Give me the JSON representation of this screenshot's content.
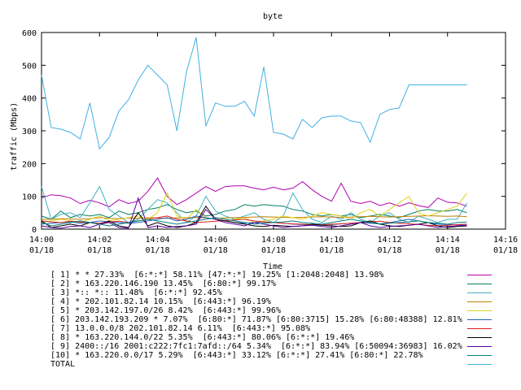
{
  "chart_data": {
    "type": "line",
    "title": "byte",
    "xlabel": "Time",
    "ylabel": "traffic (Mbps)",
    "ylim": [
      0,
      600
    ],
    "yticks": [
      0,
      100,
      200,
      300,
      400,
      500,
      600
    ],
    "grid": false,
    "xtick_labels": [
      {
        "time": "14:00",
        "date": "01/18"
      },
      {
        "time": "14:02",
        "date": "01/18"
      },
      {
        "time": "14:04",
        "date": "01/18"
      },
      {
        "time": "14:06",
        "date": "01/18"
      },
      {
        "time": "14:08",
        "date": "01/18"
      },
      {
        "time": "14:10",
        "date": "01/18"
      },
      {
        "time": "14:12",
        "date": "01/18"
      },
      {
        "time": "14:14",
        "date": "01/18"
      },
      {
        "time": "14:16",
        "date": "01/18"
      }
    ],
    "x": [
      "14:00:00",
      "14:00:20",
      "14:00:40",
      "14:01:00",
      "14:01:20",
      "14:01:40",
      "14:02:00",
      "14:02:20",
      "14:02:40",
      "14:03:00",
      "14:03:20",
      "14:03:40",
      "14:04:00",
      "14:04:20",
      "14:04:40",
      "14:05:00",
      "14:05:20",
      "14:05:40",
      "14:06:00",
      "14:06:20",
      "14:06:40",
      "14:07:00",
      "14:07:20",
      "14:07:40",
      "14:08:00",
      "14:08:20",
      "14:08:40",
      "14:09:00",
      "14:09:20",
      "14:09:40",
      "14:10:00",
      "14:10:20",
      "14:10:40",
      "14:11:00",
      "14:11:20",
      "14:11:40",
      "14:12:00",
      "14:12:20",
      "14:12:40",
      "14:13:00",
      "14:13:20",
      "14:13:40",
      "14:14:00",
      "14:14:20",
      "14:14:40"
    ],
    "series": [
      {
        "name": "[ 1] * * 27.33%  [6:*:*] 58.11% [47:*:*] 19.25% [1:2048:2048] 13.98%",
        "color": "#b000b0",
        "values": [
          95,
          105,
          102,
          95,
          78,
          88,
          80,
          68,
          90,
          78,
          85,
          115,
          156,
          100,
          75,
          90,
          110,
          130,
          115,
          130,
          132,
          132,
          125,
          120,
          128,
          120,
          125,
          145,
          120,
          100,
          85,
          140,
          85,
          78,
          85,
          72,
          80,
          70,
          80,
          72,
          66,
          95,
          82,
          80,
          70
        ]
      },
      {
        "name": "[ 2] * 163.220.146.190 13.45%  [6:80:*] 99.17%",
        "color": "#008060",
        "values": [
          40,
          30,
          55,
          35,
          45,
          40,
          45,
          35,
          55,
          45,
          50,
          60,
          65,
          75,
          60,
          50,
          55,
          40,
          45,
          55,
          60,
          75,
          70,
          75,
          72,
          70,
          60,
          55,
          45,
          40,
          45,
          40,
          45,
          35,
          40,
          45,
          40,
          35,
          45,
          55,
          60,
          55,
          55,
          60,
          50
        ]
      },
      {
        "name": "[ 3] *:: *:: 11.48%  [6:*:*] 92.45%",
        "color": "#40b0c0",
        "values": [
          130,
          30,
          45,
          50,
          35,
          80,
          130,
          60,
          40,
          20,
          30,
          60,
          90,
          80,
          50,
          20,
          40,
          100,
          55,
          40,
          30,
          40,
          50,
          30,
          20,
          40,
          110,
          60,
          30,
          20,
          40,
          30,
          50,
          30,
          20,
          40,
          50,
          30,
          20,
          40,
          30,
          20,
          30,
          30,
          80
        ]
      },
      {
        "name": "[ 4] * 202.101.82.14 10.15%  [6:443:*] 96.19%",
        "color": "#c08000",
        "values": [
          30,
          30,
          32,
          31,
          30,
          32,
          35,
          33,
          32,
          34,
          33,
          35,
          34,
          33,
          34,
          35,
          36,
          34,
          33,
          34,
          35,
          36,
          37,
          38,
          37,
          36,
          35,
          36,
          37,
          38,
          37,
          36,
          37,
          38,
          39,
          38,
          37,
          38,
          39,
          40,
          41,
          40,
          39,
          40,
          38
        ]
      },
      {
        "name": "[ 5] * 203.142.197.0/26 8.42%  [6:443:*] 99.96%",
        "color": "#e0d020",
        "values": [
          20,
          25,
          30,
          25,
          20,
          30,
          40,
          25,
          30,
          35,
          40,
          30,
          50,
          110,
          40,
          30,
          60,
          35,
          30,
          25,
          30,
          35,
          20,
          25,
          30,
          40,
          35,
          30,
          40,
          50,
          45,
          40,
          30,
          50,
          60,
          40,
          60,
          80,
          100,
          50,
          40,
          50,
          60,
          70,
          110
        ]
      },
      {
        "name": "[ 6] 203.142.193.209 * 7.07%  [6:80:*] 71.87% [6:80:3715] 15.28% [6:80:48388] 12.81%",
        "color": "#2060c0",
        "values": [
          15,
          18,
          20,
          22,
          18,
          20,
          25,
          22,
          20,
          18,
          20,
          25,
          30,
          35,
          25,
          30,
          40,
          35,
          30,
          25,
          20,
          18,
          20,
          22,
          20,
          18,
          15,
          14,
          13,
          12,
          14,
          16,
          18,
          20,
          18,
          16,
          20,
          25,
          30,
          25,
          20,
          15,
          14,
          13,
          12
        ]
      },
      {
        "name": "[ 7] 13.0.0.0/8 202.101.82.14 6.11%  [6:443:*] 95.08%",
        "color": "#e02020",
        "values": [
          25,
          22,
          20,
          24,
          22,
          20,
          18,
          22,
          24,
          20,
          25,
          30,
          35,
          40,
          30,
          25,
          20,
          22,
          24,
          26,
          28,
          30,
          25,
          22,
          20,
          18,
          16,
          15,
          14,
          13,
          15,
          16,
          18,
          20,
          22,
          24,
          20,
          18,
          16,
          14,
          12,
          10,
          12,
          14,
          15
        ]
      },
      {
        "name": "[ 8] * 163.220.144.0/22 5.35%  [6:443:*] 80.06% [6:*:*] 19.46%",
        "color": "#000000",
        "values": [
          25,
          5,
          10,
          15,
          10,
          20,
          15,
          25,
          10,
          5,
          50,
          10,
          20,
          10,
          5,
          10,
          20,
          70,
          30,
          25,
          20,
          15,
          10,
          8,
          12,
          10,
          8,
          10,
          15,
          12,
          10,
          8,
          10,
          20,
          25,
          15,
          10,
          8,
          12,
          15,
          20,
          10,
          5,
          8,
          10
        ]
      },
      {
        "name": "[ 9] 2400::/16 2001:c222:7fc1:7afd::/64 5.34%  [6:*:*] 83.94% [6:50094:36983] 16.02%",
        "color": "#6000a0",
        "values": [
          10,
          5,
          3,
          8,
          10,
          5,
          15,
          20,
          5,
          3,
          95,
          5,
          10,
          5,
          8,
          10,
          15,
          60,
          30,
          20,
          15,
          10,
          20,
          15,
          10,
          5,
          8,
          10,
          12,
          8,
          5,
          10,
          15,
          20,
          10,
          5,
          8,
          10,
          12,
          15,
          10,
          5,
          8,
          10,
          12
        ]
      },
      {
        "name": "[10] * 163.220.0.0/17 5.29%  [6:443:*] 33.12% [6:*:*] 27.41% [6:80:*] 22.78%",
        "color": "#008080",
        "values": [
          20,
          10,
          15,
          20,
          25,
          20,
          15,
          10,
          15,
          20,
          25,
          30,
          25,
          20,
          15,
          20,
          25,
          30,
          35,
          30,
          25,
          20,
          15,
          18,
          20,
          22,
          25,
          20,
          18,
          15,
          20,
          25,
          30,
          25,
          20,
          15,
          18,
          20,
          22,
          25,
          20,
          18,
          15,
          20,
          22
        ]
      },
      {
        "name": "TOTAL",
        "color": "#40b0e0",
        "values": [
          470,
          310,
          305,
          295,
          275,
          385,
          245,
          280,
          360,
          395,
          455,
          500,
          470,
          440,
          300,
          480,
          585,
          315,
          385,
          375,
          375,
          390,
          345,
          495,
          295,
          290,
          275,
          335,
          310,
          340,
          345,
          345,
          330,
          325,
          265,
          350,
          365,
          370,
          440,
          440,
          440,
          440,
          440,
          440,
          440
        ]
      }
    ]
  }
}
